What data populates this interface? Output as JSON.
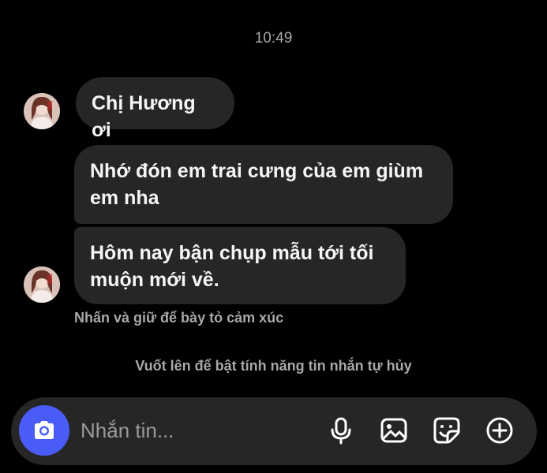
{
  "status": {
    "time": "10:49"
  },
  "messages": [
    {
      "text": "Chị Hương ơi"
    },
    {
      "text": "Nhớ đón em trai cưng của em giùm em nha"
    },
    {
      "text": "Hôm nay bận chụp mẫu tới tối muộn mới về."
    }
  ],
  "hints": {
    "reaction": "Nhấn và giữ để bày tỏ cảm xúc",
    "vanish_mode": "Vuốt lên để bật tính năng tin nhắn tự hủy"
  },
  "composer": {
    "placeholder": "Nhắn tin...",
    "icons": [
      "camera-icon",
      "microphone-icon",
      "image-icon",
      "sticker-icon",
      "plus-circle-icon"
    ]
  },
  "colors": {
    "background": "#000000",
    "bubble": "#262626",
    "accent": "#4a5cf7",
    "muted_text": "#a8a8a8"
  }
}
